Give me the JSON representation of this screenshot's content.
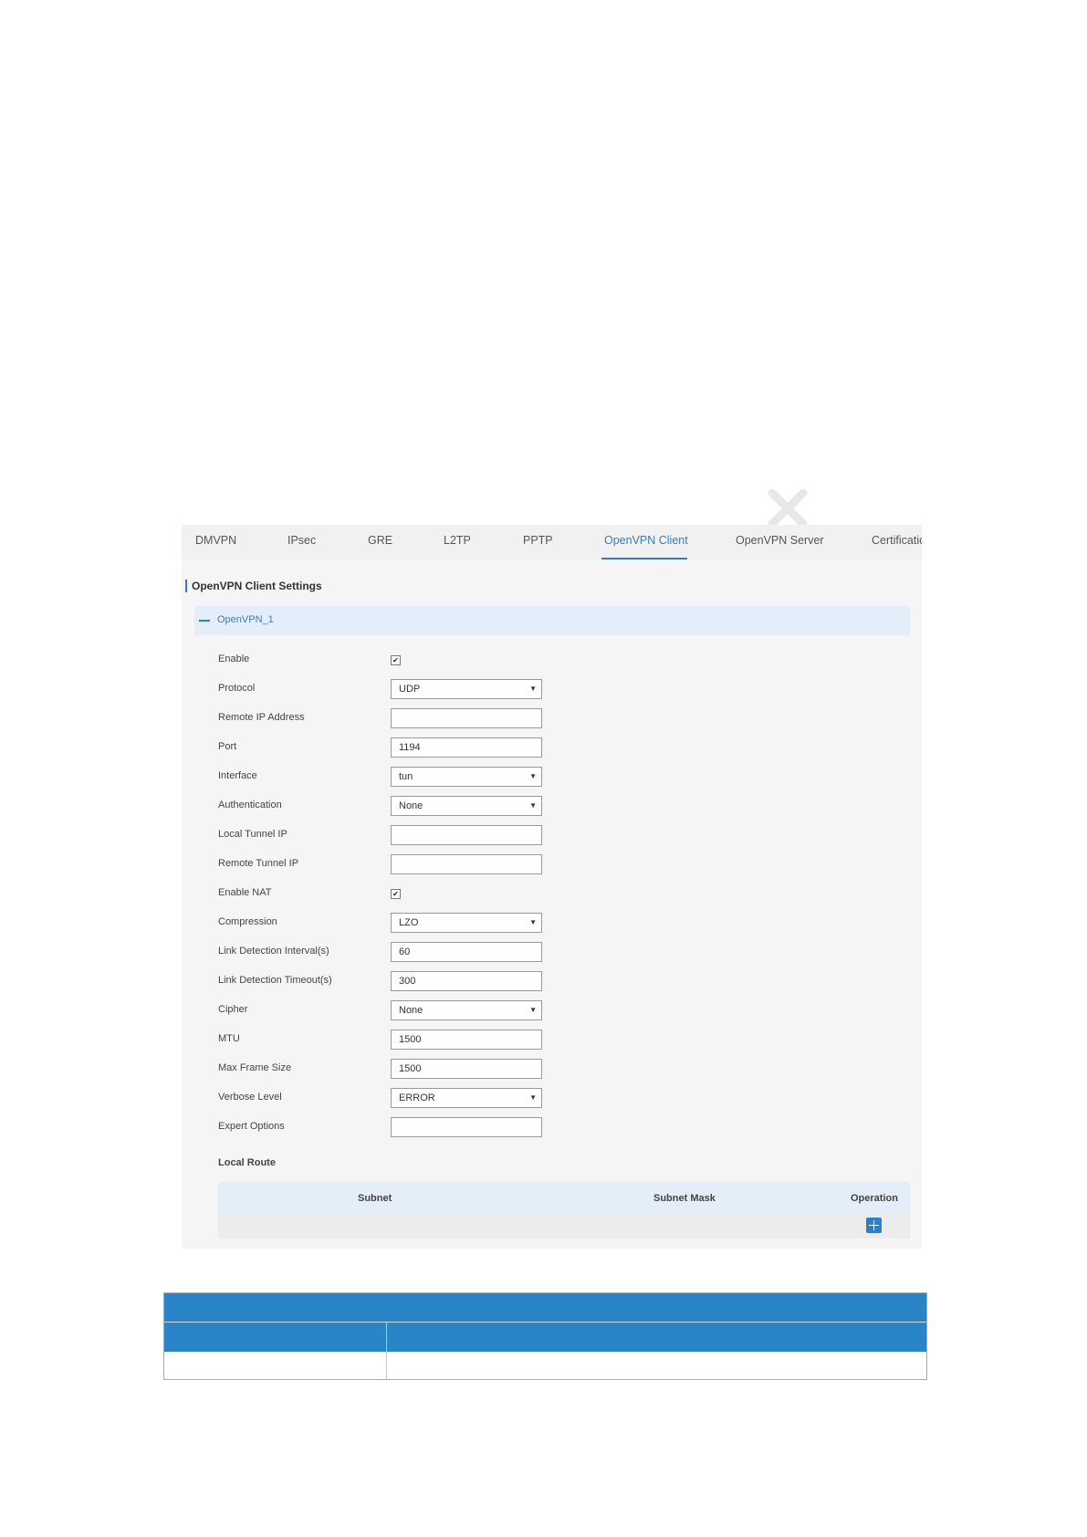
{
  "tabs": [
    {
      "label": "DMVPN",
      "active": false
    },
    {
      "label": "IPsec",
      "active": false
    },
    {
      "label": "GRE",
      "active": false
    },
    {
      "label": "L2TP",
      "active": false
    },
    {
      "label": "PPTP",
      "active": false
    },
    {
      "label": "OpenVPN Client",
      "active": true
    },
    {
      "label": "OpenVPN Server",
      "active": false
    },
    {
      "label": "Certificatio",
      "active": false
    }
  ],
  "section_title": "OpenVPN Client Settings",
  "collapse": {
    "label": "OpenVPN_1",
    "icon": "minus-icon"
  },
  "form": {
    "enable": {
      "label": "Enable",
      "checked": true
    },
    "protocol": {
      "label": "Protocol",
      "value": "UDP"
    },
    "remote_ip": {
      "label": "Remote IP Address",
      "value": ""
    },
    "port": {
      "label": "Port",
      "value": "1194"
    },
    "interface": {
      "label": "Interface",
      "value": "tun"
    },
    "authentication": {
      "label": "Authentication",
      "value": "None"
    },
    "local_tunnel_ip": {
      "label": "Local Tunnel IP",
      "value": ""
    },
    "remote_tunnel_ip": {
      "label": "Remote Tunnel IP",
      "value": ""
    },
    "enable_nat": {
      "label": "Enable NAT",
      "checked": true
    },
    "compression": {
      "label": "Compression",
      "value": "LZO"
    },
    "link_interval": {
      "label": "Link Detection Interval(s)",
      "value": "60"
    },
    "link_timeout": {
      "label": "Link Detection Timeout(s)",
      "value": "300"
    },
    "cipher": {
      "label": "Cipher",
      "value": "None"
    },
    "mtu": {
      "label": "MTU",
      "value": "1500"
    },
    "max_frame": {
      "label": "Max Frame Size",
      "value": "1500"
    },
    "verbose": {
      "label": "Verbose Level",
      "value": "ERROR"
    },
    "expert": {
      "label": "Expert Options",
      "value": ""
    }
  },
  "local_route": {
    "title": "Local Route",
    "columns": [
      "Subnet",
      "Subnet Mask",
      "Operation"
    ],
    "add_icon": "plus-icon"
  },
  "colors": {
    "accent": "#2f7fc2",
    "table_header_blue": "#2a85c8",
    "panel_bg": "#f5f5f5",
    "highlight_bg": "#e4eef8"
  }
}
